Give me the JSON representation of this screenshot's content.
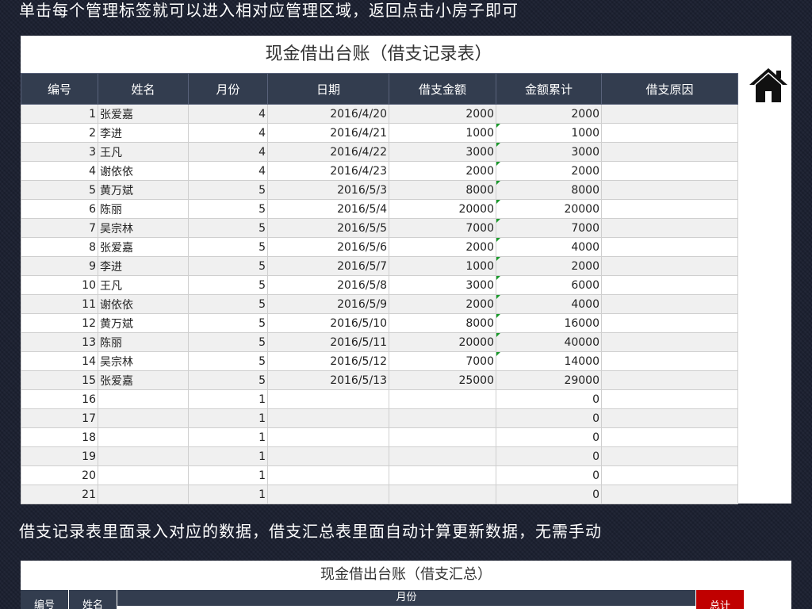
{
  "captions": {
    "top": "单击每个管理标签就可以进入相对应管理区域，返回点击小房子即可",
    "middle": "借支记录表里面录入对应的数据，借支汇总表里面自动计算更新数据，无需手动"
  },
  "ledger": {
    "title": "现金借出台账（借支记录表）",
    "home_icon": "home-icon",
    "columns": [
      "编号",
      "姓名",
      "月份",
      "日期",
      "借支金额",
      "金额累计",
      "借支原因"
    ],
    "rows": [
      {
        "no": "1",
        "name": "张爱嘉",
        "month": "4",
        "date": "2016/4/20",
        "amount": "2000",
        "total": "2000",
        "reason": ""
      },
      {
        "no": "2",
        "name": "李进",
        "month": "4",
        "date": "2016/4/21",
        "amount": "1000",
        "total": "1000",
        "reason": ""
      },
      {
        "no": "3",
        "name": "王凡",
        "month": "4",
        "date": "2016/4/22",
        "amount": "3000",
        "total": "3000",
        "reason": ""
      },
      {
        "no": "4",
        "name": "谢依依",
        "month": "4",
        "date": "2016/4/23",
        "amount": "2000",
        "total": "2000",
        "reason": ""
      },
      {
        "no": "5",
        "name": "黄万斌",
        "month": "5",
        "date": "2016/5/3",
        "amount": "8000",
        "total": "8000",
        "reason": ""
      },
      {
        "no": "6",
        "name": "陈丽",
        "month": "5",
        "date": "2016/5/4",
        "amount": "20000",
        "total": "20000",
        "reason": ""
      },
      {
        "no": "7",
        "name": "吴宗林",
        "month": "5",
        "date": "2016/5/5",
        "amount": "7000",
        "total": "7000",
        "reason": ""
      },
      {
        "no": "8",
        "name": "张爱嘉",
        "month": "5",
        "date": "2016/5/6",
        "amount": "2000",
        "total": "4000",
        "reason": ""
      },
      {
        "no": "9",
        "name": "李进",
        "month": "5",
        "date": "2016/5/7",
        "amount": "1000",
        "total": "2000",
        "reason": ""
      },
      {
        "no": "10",
        "name": "王凡",
        "month": "5",
        "date": "2016/5/8",
        "amount": "3000",
        "total": "6000",
        "reason": ""
      },
      {
        "no": "11",
        "name": "谢依依",
        "month": "5",
        "date": "2016/5/9",
        "amount": "2000",
        "total": "4000",
        "reason": ""
      },
      {
        "no": "12",
        "name": "黄万斌",
        "month": "5",
        "date": "2016/5/10",
        "amount": "8000",
        "total": "16000",
        "reason": ""
      },
      {
        "no": "13",
        "name": "陈丽",
        "month": "5",
        "date": "2016/5/11",
        "amount": "20000",
        "total": "40000",
        "reason": ""
      },
      {
        "no": "14",
        "name": "吴宗林",
        "month": "5",
        "date": "2016/5/12",
        "amount": "7000",
        "total": "14000",
        "reason": ""
      },
      {
        "no": "15",
        "name": "张爱嘉",
        "month": "5",
        "date": "2016/5/13",
        "amount": "25000",
        "total": "29000",
        "reason": ""
      },
      {
        "no": "16",
        "name": "",
        "month": "1",
        "date": "",
        "amount": "",
        "total": "0",
        "reason": ""
      },
      {
        "no": "17",
        "name": "",
        "month": "1",
        "date": "",
        "amount": "",
        "total": "0",
        "reason": ""
      },
      {
        "no": "18",
        "name": "",
        "month": "1",
        "date": "",
        "amount": "",
        "total": "0",
        "reason": ""
      },
      {
        "no": "19",
        "name": "",
        "month": "1",
        "date": "",
        "amount": "",
        "total": "0",
        "reason": ""
      },
      {
        "no": "20",
        "name": "",
        "month": "1",
        "date": "",
        "amount": "",
        "total": "0",
        "reason": ""
      },
      {
        "no": "21",
        "name": "",
        "month": "1",
        "date": "",
        "amount": "",
        "total": "0",
        "reason": ""
      }
    ]
  },
  "summary": {
    "title": "现金借出台账（借支汇总）",
    "col_no": "编号",
    "col_name": "姓名",
    "col_month": "月份",
    "col_total": "总计"
  }
}
